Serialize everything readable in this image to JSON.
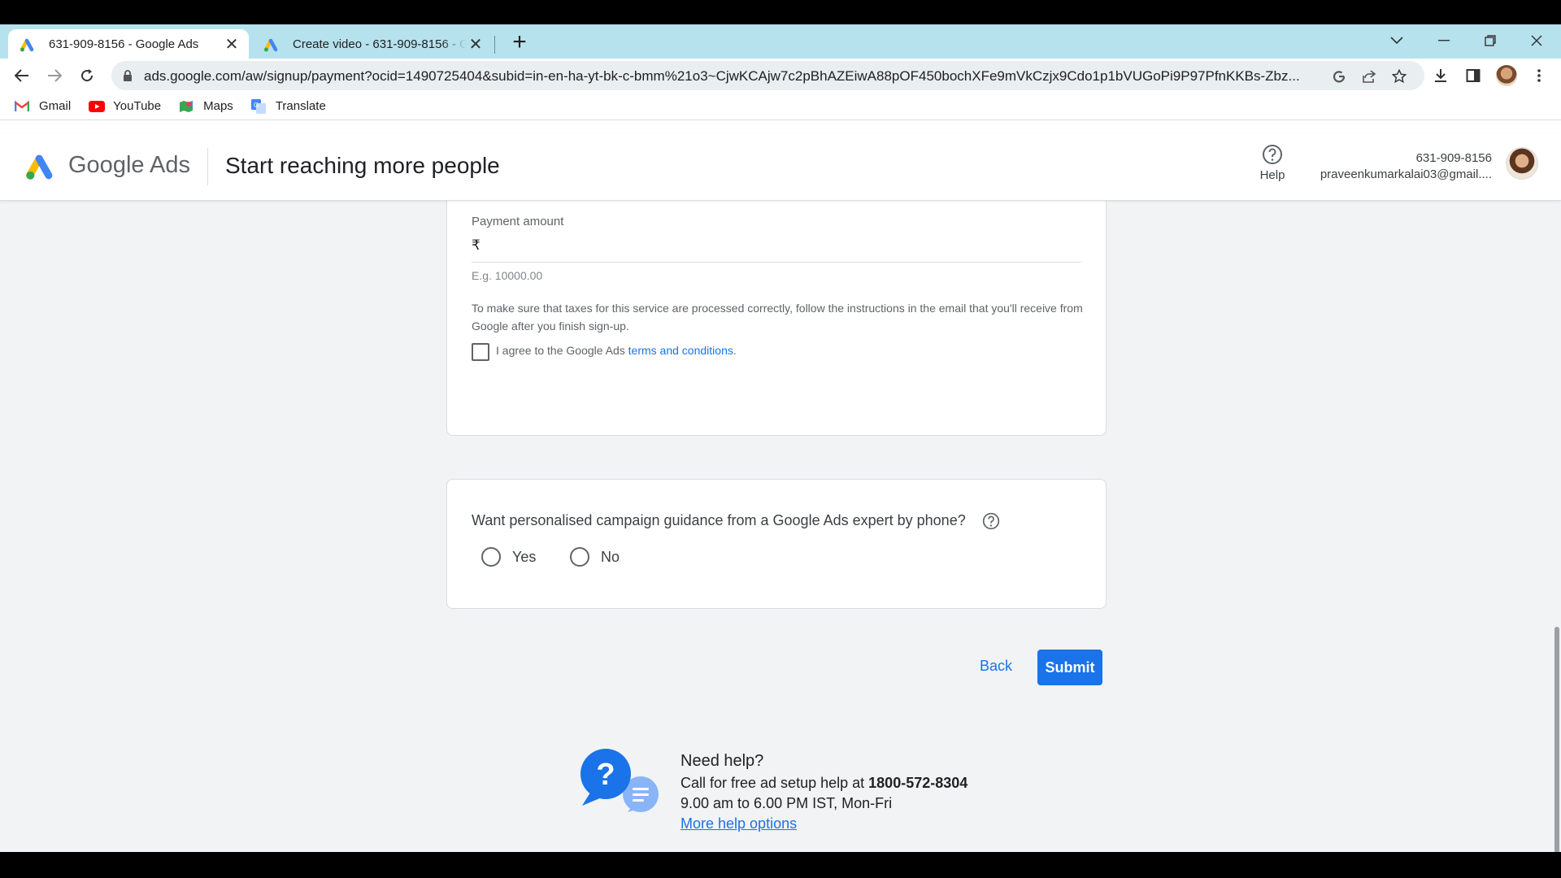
{
  "browser": {
    "tabs": [
      {
        "title": "631-909-8156 - Google Ads",
        "active": true
      },
      {
        "title": "Create video - 631-909-8156 - Goo",
        "active": false
      }
    ],
    "url": "ads.google.com/aw/signup/payment?ocid=1490725404&subid=in-en-ha-yt-bk-c-bmm%21o3~CjwKCAjw7c2pBhAZEiwA88pOF450bochXFe9mVkCzjx9Cdo1p1bVUGoPi9P97PfnKKBs-Zbz...",
    "bookmarks": [
      {
        "label": "Gmail",
        "icon": "gmail-icon"
      },
      {
        "label": "YouTube",
        "icon": "youtube-icon"
      },
      {
        "label": "Maps",
        "icon": "maps-icon"
      },
      {
        "label": "Translate",
        "icon": "translate-icon"
      }
    ]
  },
  "header": {
    "brand_google": "Google",
    "brand_ads": "Ads",
    "title": "Start reaching more people",
    "help_label": "Help",
    "account_id": "631-909-8156",
    "account_email": "praveenkumarkalai03@gmail...."
  },
  "payment": {
    "amount_label": "Payment amount",
    "currency_symbol": "₹",
    "amount_value": "",
    "amount_hint": "E.g. 10000.00",
    "tax_note": "To make sure that taxes for this service are processed correctly, follow the instructions in the email that you'll receive from Google after you finish sign-up.",
    "agree_prefix": "I agree to the Google Ads",
    "agree_link": "terms and conditions",
    "agree_suffix": ".",
    "agree_checked": false
  },
  "guidance": {
    "question": "Want personalised campaign guidance from a Google Ads expert by phone?",
    "option_yes": "Yes",
    "option_no": "No"
  },
  "actions": {
    "back_label": "Back",
    "submit_label": "Submit"
  },
  "need_help": {
    "title": "Need help?",
    "call_text": "Call for free ad setup help at",
    "phone": "1800-572-8304",
    "hours": "9.00 am to 6.00 PM IST, Mon-Fri",
    "more_link": "More help options"
  },
  "colors": {
    "accent": "#1a73e8",
    "tabstrip": "#b6e2ee",
    "page_bg": "#f1f3f4"
  }
}
